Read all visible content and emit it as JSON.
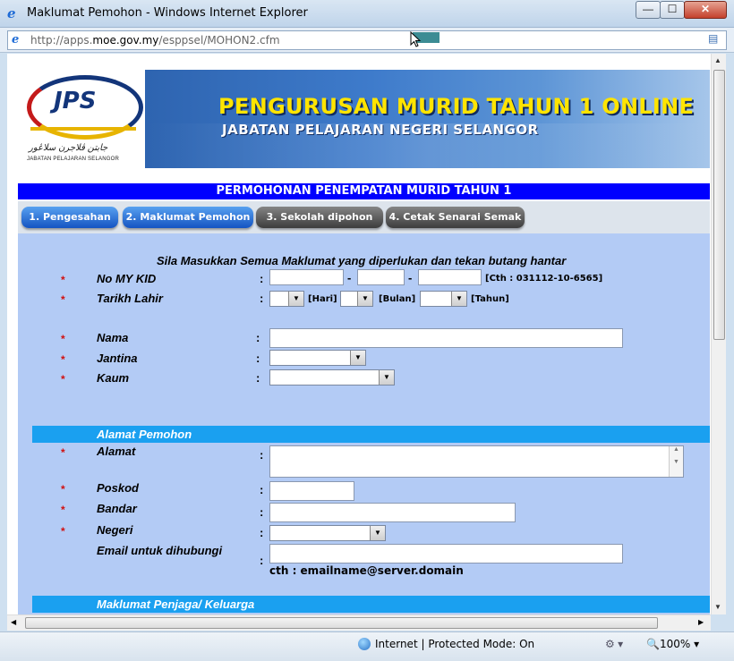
{
  "window": {
    "title": "Maklumat Pemohon - Windows Internet Explorer",
    "min_label": "—",
    "max_label": "☐",
    "close_label": "✕"
  },
  "address": {
    "url_prefix": "http://apps.",
    "url_domain": "moe.gov.my",
    "url_suffix": "/esppsel/MOHON2.cfm"
  },
  "banner": {
    "logo_text": "JPS",
    "logo_jawi": "جابتن ڤلاجرن سلاڠور",
    "logo_sub": "JABATAN PELAJARAN SELANGOR",
    "title": "PENGURUSAN MURID TAHUN 1 ONLINE",
    "subtitle": "JABATAN PELAJARAN NEGERI SELANGOR"
  },
  "form_title": "PERMOHONAN PENEMPATAN MURID TAHUN 1",
  "tabs": [
    {
      "label": "1. Pengesahan",
      "state": "active"
    },
    {
      "label": "2. Maklumat Pemohon",
      "state": "active"
    },
    {
      "label": "3. Sekolah dipohon",
      "state": "disabled"
    },
    {
      "label": "4. Cetak Senarai Semak",
      "state": "disabled"
    }
  ],
  "instruction": "Sila Masukkan Semua Maklumat yang diperlukan dan tekan butang hantar",
  "fields": {
    "mykid": {
      "label": "No MY KID",
      "part1": "",
      "part2": "",
      "part3": "",
      "sep": "-",
      "example": "[Cth : 031112-10-6565]"
    },
    "dob": {
      "label": "Tarikh Lahir",
      "day": "",
      "month": "",
      "year": "",
      "day_label": "[Hari]",
      "month_label": "[Bulan]",
      "year_label": "[Tahun]"
    },
    "nama": {
      "label": "Nama",
      "value": ""
    },
    "jantina": {
      "label": "Jantina",
      "value": ""
    },
    "kaum": {
      "label": "Kaum",
      "value": ""
    },
    "alamat": {
      "label": "Alamat",
      "value": ""
    },
    "poskod": {
      "label": "Poskod",
      "value": ""
    },
    "bandar": {
      "label": "Bandar",
      "value": ""
    },
    "negeri": {
      "label": "Negeri",
      "value": ""
    },
    "email": {
      "label": "Email untuk dihubungi",
      "value": "",
      "hint": "cth : emailname@server.domain"
    }
  },
  "sections": {
    "alamat": "Alamat Pemohon",
    "penjaga": "Maklumat Penjaga/ Keluarga"
  },
  "status": {
    "zone": "Internet | Protected Mode: On",
    "zoom": "100%"
  },
  "colors": {
    "form_bg": "#b3cbf5",
    "title_bar": "#0000ff",
    "section_bar": "#1aa0f0",
    "required": "#d01010"
  }
}
